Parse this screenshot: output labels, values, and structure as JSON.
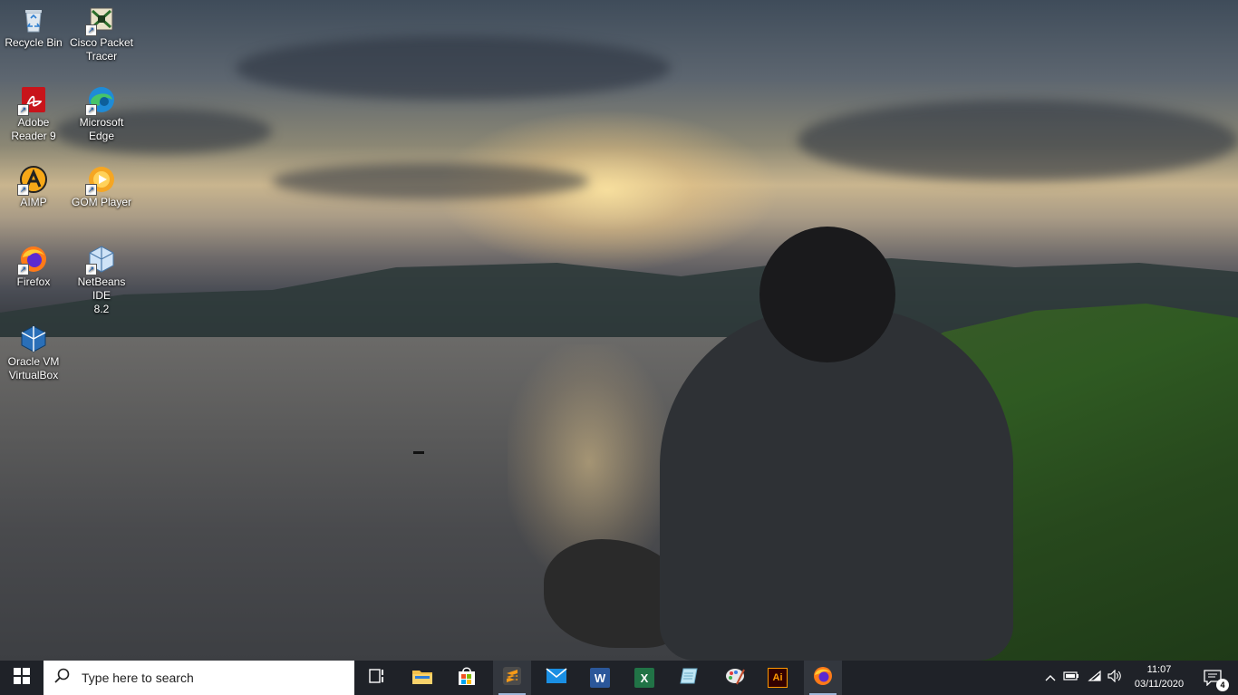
{
  "desktop": {
    "icons": [
      {
        "label_line1": "Recycle Bin",
        "label_line2": "",
        "icon": "recycle-bin-icon"
      },
      {
        "label_line1": "Cisco Packet",
        "label_line2": "Tracer",
        "icon": "cisco-packet-tracer-icon"
      },
      {
        "label_line1": "Adobe",
        "label_line2": "Reader 9",
        "icon": "adobe-reader-icon"
      },
      {
        "label_line1": "Microsoft",
        "label_line2": "Edge",
        "icon": "edge-icon"
      },
      {
        "label_line1": "AIMP",
        "label_line2": "",
        "icon": "aimp-icon"
      },
      {
        "label_line1": "GOM Player",
        "label_line2": "",
        "icon": "gom-player-icon"
      },
      {
        "label_line1": "Firefox",
        "label_line2": "",
        "icon": "firefox-icon"
      },
      {
        "label_line1": "NetBeans IDE",
        "label_line2": "8.2",
        "icon": "netbeans-icon"
      },
      {
        "label_line1": "Oracle VM",
        "label_line2": "VirtualBox",
        "icon": "virtualbox-icon"
      }
    ]
  },
  "taskbar": {
    "search_placeholder": "Type here to search",
    "pinned_apps": [
      {
        "name": "task-view",
        "icon": "task-view-icon"
      },
      {
        "name": "file-explorer",
        "icon": "folder-icon"
      },
      {
        "name": "microsoft-store",
        "icon": "store-icon"
      },
      {
        "name": "sublime-text",
        "icon": "sublime-text-icon"
      },
      {
        "name": "mail",
        "icon": "mail-icon"
      },
      {
        "name": "word",
        "icon": "word-icon"
      },
      {
        "name": "excel",
        "icon": "excel-icon"
      },
      {
        "name": "notepad",
        "icon": "notepad-icon"
      },
      {
        "name": "paint",
        "icon": "paint-icon"
      },
      {
        "name": "illustrator",
        "icon": "illustrator-icon"
      },
      {
        "name": "firefox",
        "icon": "firefox-icon"
      }
    ],
    "illustrator_label": "Ai",
    "word_label": "W",
    "excel_label": "X",
    "clock": {
      "time": "11:07",
      "date": "03/11/2020"
    },
    "notification_count": "4"
  },
  "colors": {
    "taskbar_bg": "#1f2228",
    "search_bg": "#ffffff",
    "running_indicator": "#9fb7d9"
  }
}
